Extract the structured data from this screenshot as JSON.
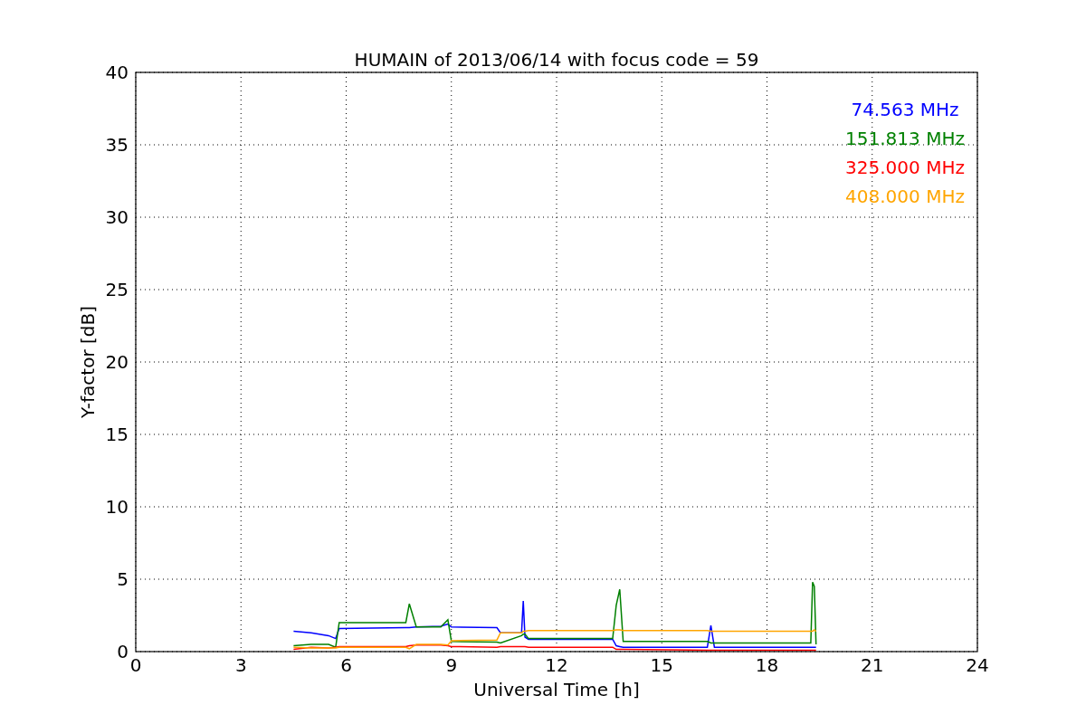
{
  "figure": {
    "chart_data": {
      "type": "line",
      "title": "HUMAIN of 2013/06/14 with focus code = 59",
      "xlabel": "Universal Time [h]",
      "ylabel": "Y-factor [dB]",
      "xlim": [
        0,
        24
      ],
      "ylim": [
        0,
        40
      ],
      "grid": true,
      "xticks": [
        0,
        3,
        6,
        9,
        12,
        15,
        18,
        21,
        24
      ],
      "yticks": [
        0,
        5,
        10,
        15,
        20,
        25,
        30,
        35,
        40
      ],
      "x": [
        4.5,
        5.0,
        5.5,
        5.7,
        5.8,
        7.7,
        7.8,
        8.0,
        8.7,
        8.9,
        9.0,
        10.3,
        10.4,
        11.0,
        11.05,
        11.1,
        11.2,
        13.6,
        13.7,
        13.8,
        13.9,
        16.3,
        16.4,
        16.5,
        19.25,
        19.3,
        19.35,
        19.4
      ],
      "series": [
        {
          "name": "74.563 MHz",
          "color": "#0000ff",
          "values": [
            1.4,
            1.3,
            1.1,
            0.9,
            1.6,
            1.65,
            1.65,
            1.7,
            1.75,
            1.9,
            1.7,
            1.65,
            1.3,
            1.3,
            3.5,
            1.0,
            0.85,
            0.85,
            0.4,
            0.35,
            0.3,
            0.3,
            1.8,
            0.3,
            0.3,
            0.3,
            0.3,
            0.3
          ]
        },
        {
          "name": "151.813 MHz",
          "color": "#008000",
          "values": [
            0.4,
            0.5,
            0.5,
            0.3,
            2.0,
            2.0,
            3.3,
            1.7,
            1.7,
            2.2,
            0.7,
            0.65,
            0.6,
            1.1,
            1.2,
            1.2,
            0.9,
            0.9,
            3.2,
            4.3,
            0.7,
            0.7,
            0.6,
            0.6,
            0.6,
            4.8,
            4.5,
            0.5
          ]
        },
        {
          "name": "325.000 MHz",
          "color": "#ff0000",
          "values": [
            0.15,
            0.3,
            0.25,
            0.3,
            0.35,
            0.35,
            0.4,
            0.45,
            0.45,
            0.4,
            0.35,
            0.3,
            0.35,
            0.35,
            0.35,
            0.35,
            0.3,
            0.3,
            0.15,
            0.15,
            0.15,
            0.1,
            0.1,
            0.1,
            0.1,
            0.1,
            0.1,
            0.1
          ]
        },
        {
          "name": "408.000 MHz",
          "color": "#ffa500",
          "values": [
            0.3,
            0.25,
            0.25,
            0.25,
            0.3,
            0.3,
            0.2,
            0.5,
            0.5,
            0.45,
            0.75,
            0.8,
            1.3,
            1.3,
            1.4,
            1.4,
            1.45,
            1.45,
            1.5,
            1.5,
            1.45,
            1.45,
            1.4,
            1.4,
            1.4,
            1.4,
            1.5,
            1.4
          ]
        }
      ]
    }
  }
}
